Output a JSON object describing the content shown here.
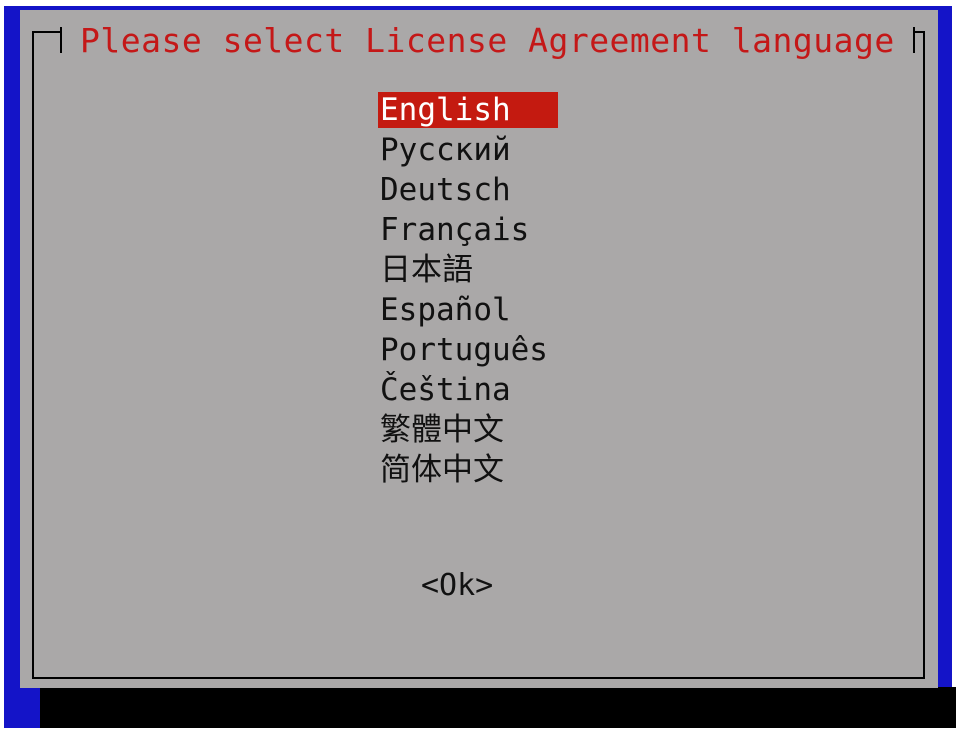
{
  "dialog": {
    "title": "Please select License Agreement language",
    "languages": [
      {
        "label": "English",
        "selected": true
      },
      {
        "label": "Русский",
        "selected": false
      },
      {
        "label": "Deutsch",
        "selected": false
      },
      {
        "label": "Français",
        "selected": false
      },
      {
        "label": "日本語",
        "selected": false
      },
      {
        "label": "Español",
        "selected": false
      },
      {
        "label": "Português",
        "selected": false
      },
      {
        "label": "Čeština",
        "selected": false
      },
      {
        "label": "繁體中文",
        "selected": false
      },
      {
        "label": "简体中文",
        "selected": false
      }
    ],
    "ok_label": "<Ok>"
  },
  "colors": {
    "background": "#1414c8",
    "dialog": "#aaa8a8",
    "title": "#c41818",
    "selection": "#c41a10",
    "shadow": "#000000"
  }
}
